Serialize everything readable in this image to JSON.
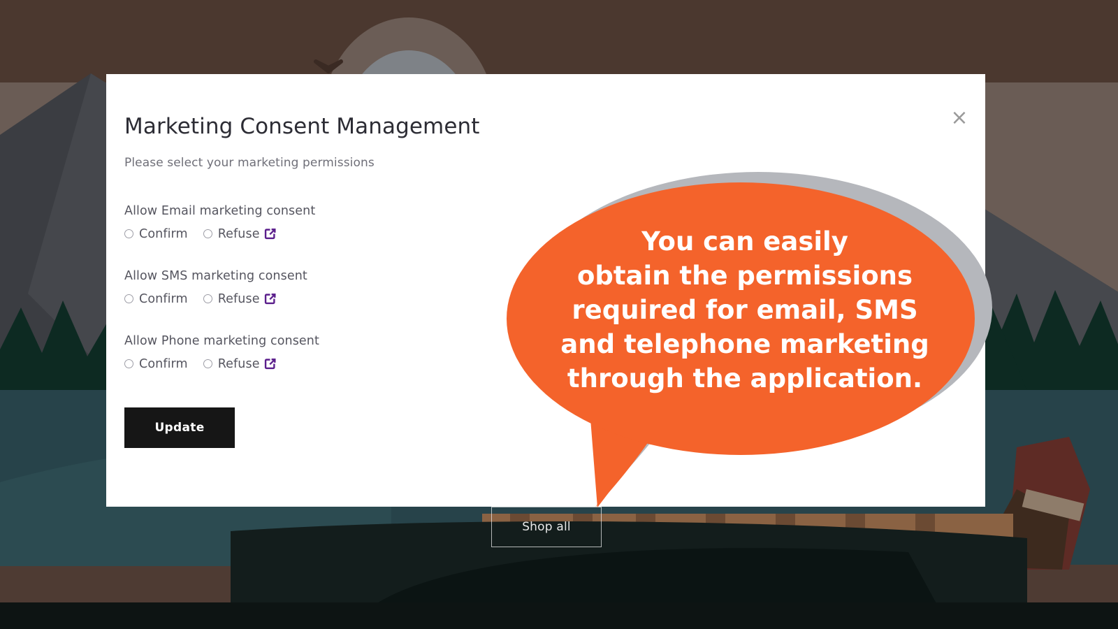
{
  "background": {
    "scene_name": "campfire-lake-landscape",
    "colors": {
      "sky": "#4e3b33",
      "sky_band": "#6a5c55",
      "sky_band_low": "#5e4035",
      "moon": "#7e8287",
      "mountain": "#3e4045",
      "mountain_light": "#4c4e53",
      "pines": "#0d2a22",
      "water": "#27434a",
      "water_light": "#2c4b51",
      "boat": "#101a19",
      "boat_wood": "#8a6243",
      "person_shirt": "#5e2b25",
      "person_pants": "#3d2a1e",
      "bird": "#3a2a23"
    }
  },
  "page": {
    "shop_all_label": "Shop all"
  },
  "modal": {
    "title": "Marketing Consent Management",
    "subtitle": "Please select your marketing permissions",
    "close_label": "×",
    "close_icon": "close-icon",
    "update_label": "Update",
    "consents": [
      {
        "id": "email",
        "label": "Allow Email marketing consent",
        "options": [
          {
            "value": "confirm",
            "label": "Confirm",
            "selected": false
          },
          {
            "value": "refuse",
            "label": "Refuse",
            "selected": false
          }
        ],
        "link_icon": "external-link-icon"
      },
      {
        "id": "sms",
        "label": "Allow SMS marketing consent",
        "options": [
          {
            "value": "confirm",
            "label": "Confirm",
            "selected": false
          },
          {
            "value": "refuse",
            "label": "Refuse",
            "selected": false
          }
        ],
        "link_icon": "external-link-icon"
      },
      {
        "id": "phone",
        "label": "Allow Phone marketing consent",
        "options": [
          {
            "value": "confirm",
            "label": "Confirm",
            "selected": false
          },
          {
            "value": "refuse",
            "label": "Refuse",
            "selected": false
          }
        ],
        "link_icon": "external-link-icon"
      }
    ]
  },
  "callout": {
    "text": "You can easily\nobtain the permissions\nrequired for email, SMS\nand telephone marketing\nthrough the application.",
    "fill_color": "#F4632B",
    "shadow_color": "#B5B7BC",
    "text_color": "#FFFFFF"
  },
  "accent_colors": {
    "external_link": "#5B1F8C",
    "button_bg": "#161616",
    "button_text": "#FFFFFF",
    "title_text": "#2C2C34",
    "body_text": "#55555F",
    "muted_text": "#6F6F78"
  }
}
